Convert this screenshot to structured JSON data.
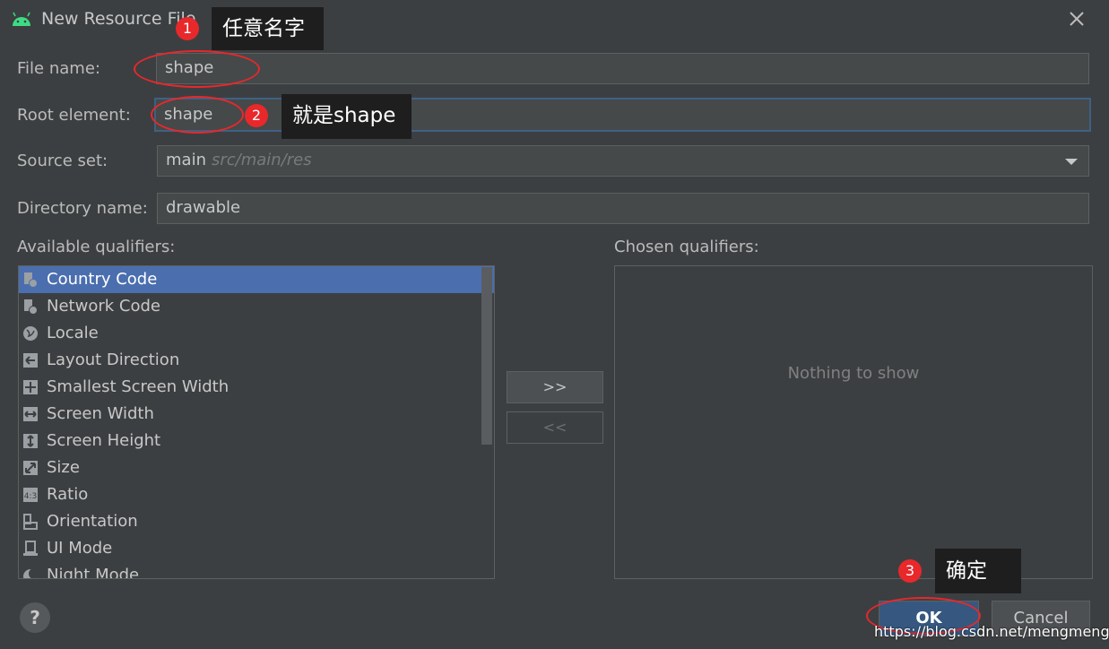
{
  "window": {
    "title": "New Resource File"
  },
  "form": {
    "file_name_label": "File name:",
    "file_name_value": "shape",
    "root_element_label": "Root element:",
    "root_element_value": "shape",
    "source_set_label": "Source set:",
    "source_set_value": "main",
    "source_set_path": "src/main/res",
    "directory_name_label": "Directory name:",
    "directory_name_value": "drawable"
  },
  "qualifiers": {
    "available_label": "Available qualifiers:",
    "chosen_label": "Chosen qualifiers:",
    "empty_text": "Nothing to show",
    "items": [
      {
        "label": "Country Code",
        "icon": "country-code-icon",
        "selected": true
      },
      {
        "label": "Network Code",
        "icon": "network-code-icon"
      },
      {
        "label": "Locale",
        "icon": "globe-icon"
      },
      {
        "label": "Layout Direction",
        "icon": "layout-direction-icon"
      },
      {
        "label": "Smallest Screen Width",
        "icon": "smallest-width-icon"
      },
      {
        "label": "Screen Width",
        "icon": "screen-width-icon"
      },
      {
        "label": "Screen Height",
        "icon": "screen-height-icon"
      },
      {
        "label": "Size",
        "icon": "size-icon"
      },
      {
        "label": "Ratio",
        "icon": "ratio-icon"
      },
      {
        "label": "Orientation",
        "icon": "orientation-icon"
      },
      {
        "label": "UI Mode",
        "icon": "ui-mode-icon"
      },
      {
        "label": "Night Mode",
        "icon": "night-mode-icon"
      }
    ],
    "add_button": ">>",
    "remove_button": "<<"
  },
  "buttons": {
    "help": "?",
    "ok": "OK",
    "cancel": "Cancel"
  },
  "annotations": {
    "callout1_number": "1",
    "callout1_text": "任意名字",
    "callout2_number": "2",
    "callout2_text": "就是shape",
    "callout3_number": "3",
    "callout3_text": "确定"
  },
  "watermark": "https://blog.csdn.net/mengmengde_",
  "colors": {
    "accent": "#4b6eaf",
    "ok_button": "#365880",
    "annotation_red": "#e8282b",
    "background": "#3c3f41"
  }
}
